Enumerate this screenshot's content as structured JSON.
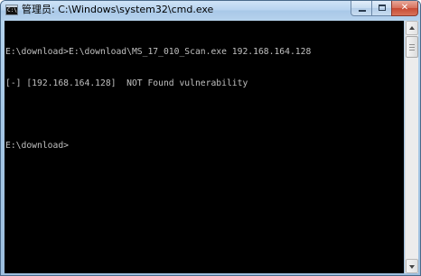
{
  "window": {
    "title": "管理员: C:\\Windows\\system32\\cmd.exe",
    "icon": {
      "name": "cmd-icon",
      "text": "C:\\"
    },
    "controls": {
      "minimize": "minimize-icon",
      "maximize": "maximize-icon",
      "close": "close-icon",
      "close_glyph": "✕"
    }
  },
  "console": {
    "lines": [
      "E:\\download>E:\\download\\MS_17_010_Scan.exe 192.168.164.128",
      "[-] [192.168.164.128]  NOT Found vulnerability",
      "",
      "E:\\download>"
    ],
    "text_color": "#c0c0c0",
    "background_color": "#000000"
  },
  "scrollbar": {
    "up_icon": "arrow-up-icon",
    "down_icon": "arrow-down-icon",
    "thumb_position": 0
  }
}
